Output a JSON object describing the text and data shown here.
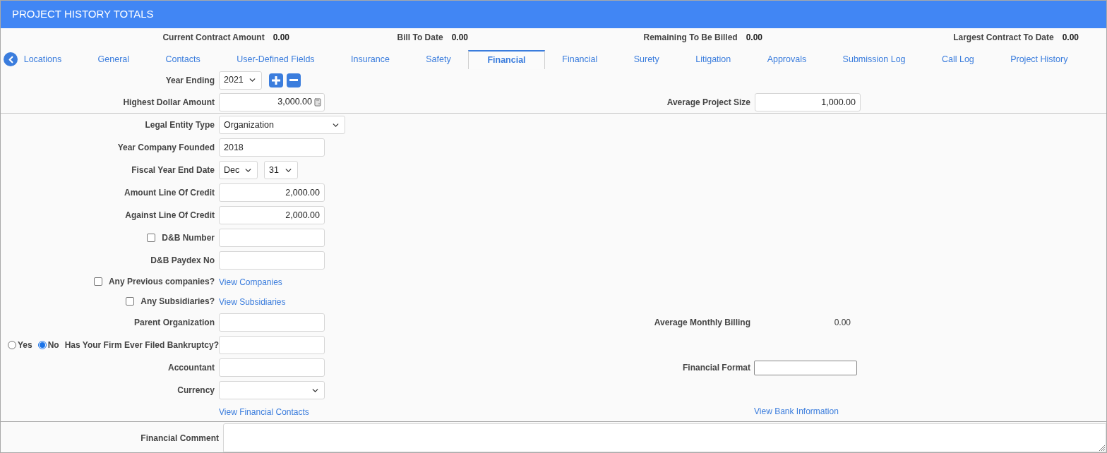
{
  "title": "PROJECT HISTORY TOTALS",
  "totals": [
    {
      "label": "Current Contract Amount",
      "value": "0.00"
    },
    {
      "label": "Bill To Date",
      "value": "0.00"
    },
    {
      "label": "Remaining To Be Billed",
      "value": "0.00"
    },
    {
      "label": "Largest Contract To Date",
      "value": "0.00"
    }
  ],
  "tabs": [
    {
      "label": "Locations",
      "selected": false
    },
    {
      "label": "General",
      "selected": false
    },
    {
      "label": "Contacts",
      "selected": false
    },
    {
      "label": "User-Defined Fields",
      "selected": false
    },
    {
      "label": "Insurance",
      "selected": false
    },
    {
      "label": "Safety",
      "selected": false
    },
    {
      "label": "Financial",
      "selected": true
    },
    {
      "label": "Financial",
      "selected": false
    },
    {
      "label": "Surety",
      "selected": false
    },
    {
      "label": "Litigation",
      "selected": false
    },
    {
      "label": "Approvals",
      "selected": false
    },
    {
      "label": "Submission Log",
      "selected": false
    },
    {
      "label": "Call Log",
      "selected": false
    },
    {
      "label": "Project History",
      "selected": false
    }
  ],
  "year_ending": {
    "label": "Year Ending",
    "value": "2021"
  },
  "highest_dollar_amount": {
    "label": "Highest Dollar Amount",
    "value": "3,000.00"
  },
  "average_project_size": {
    "label": "Average Project Size",
    "value": "1,000.00"
  },
  "rows": [
    {
      "kind": "wide_select",
      "label": "Legal Entity Type",
      "value": "Organization"
    },
    {
      "kind": "text",
      "label": "Year Company Founded",
      "value": "2018"
    },
    {
      "kind": "date",
      "label": "Fiscal Year End Date",
      "month": "Dec",
      "day": "31"
    },
    {
      "kind": "amount",
      "label": "Amount Line Of Credit",
      "value": "2,000.00"
    },
    {
      "kind": "amount",
      "label": "Against Line Of Credit",
      "value": "2,000.00"
    },
    {
      "kind": "check_text",
      "label": "D&B Number",
      "checked": false
    },
    {
      "kind": "text",
      "label": "D&B Paydex No"
    },
    {
      "kind": "check_link",
      "label": "Any Previous companies?",
      "checked": false,
      "link": "View Companies"
    },
    {
      "kind": "check_link",
      "label": "Any Subsidiaries?",
      "checked": false,
      "link": "View Subsidiaries"
    },
    {
      "kind": "text",
      "label": "Parent Organization",
      "right": {
        "kind": "reading",
        "label": "Average Monthly Billing",
        "value": "0.00"
      }
    },
    {
      "kind": "radio_text",
      "label": "Has Your Firm Ever Filed Bankruptcy?",
      "options": [
        {
          "label": "Yes",
          "selected": false
        },
        {
          "label": "No",
          "selected": true
        }
      ]
    },
    {
      "kind": "text",
      "label": "Accountant",
      "right": {
        "kind": "field",
        "label": "Financial Format"
      }
    },
    {
      "kind": "select",
      "label": "Currency"
    },
    {
      "kind": "link",
      "link": "View Financial Contacts",
      "right": {
        "kind": "link",
        "link": "View Bank Information"
      }
    }
  ],
  "financial_comment": {
    "label": "Financial Comment"
  }
}
